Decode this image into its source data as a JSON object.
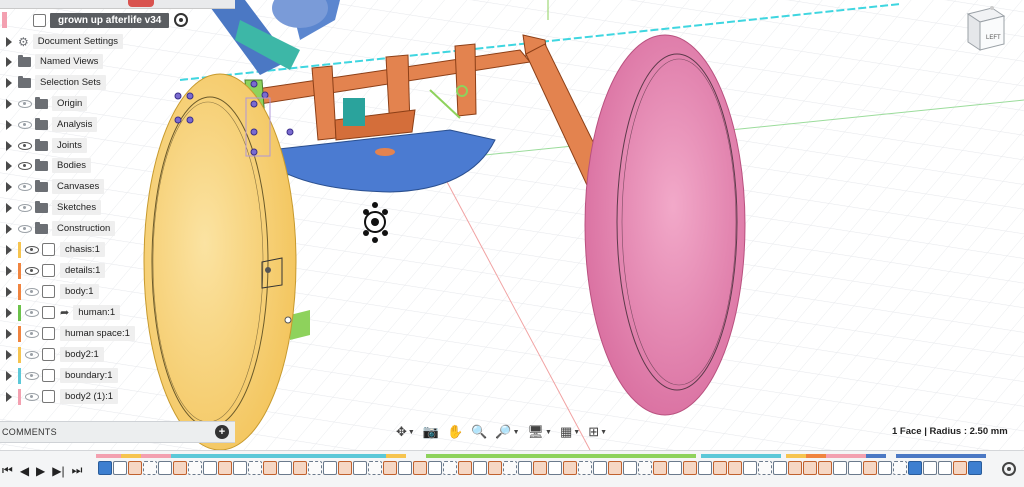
{
  "document": {
    "title": "grown up afterlife v34"
  },
  "browser": {
    "items": [
      {
        "label": "Document Settings",
        "kind": "settings"
      },
      {
        "label": "Named Views",
        "kind": "folder"
      },
      {
        "label": "Selection Sets",
        "kind": "folder"
      },
      {
        "label": "Origin",
        "kind": "folder"
      },
      {
        "label": "Analysis",
        "kind": "folder"
      },
      {
        "label": "Joints",
        "kind": "folder"
      },
      {
        "label": "Bodies",
        "kind": "folder"
      },
      {
        "label": "Canvases",
        "kind": "folder"
      },
      {
        "label": "Sketches",
        "kind": "folder"
      },
      {
        "label": "Construction",
        "kind": "folder"
      },
      {
        "label": "chasis:1",
        "kind": "component",
        "color": "#f6c44f"
      },
      {
        "label": "details:1",
        "kind": "component",
        "color": "#f0843f"
      },
      {
        "label": "body:1",
        "kind": "component",
        "color": "#f0843f"
      },
      {
        "label": "human:1",
        "kind": "component",
        "color": "#6cc24a"
      },
      {
        "label": "human space:1",
        "kind": "component",
        "color": "#f0843f"
      },
      {
        "label": "body2:1",
        "kind": "component",
        "color": "#f6c44f"
      },
      {
        "label": "boundary:1",
        "kind": "component",
        "color": "#5bc8d8"
      },
      {
        "label": "body2 (1):1",
        "kind": "component",
        "color": "#f3a0b0"
      }
    ]
  },
  "viewcube": {
    "face_label": "LEFT"
  },
  "comments": {
    "label": "COMMENTS",
    "add_symbol": "+"
  },
  "status": {
    "selection": "1 Face | Radius : 2.50 mm"
  },
  "nav_toolbar": {
    "tools": [
      "move-icon",
      "capture-icon",
      "pan-icon",
      "zoom-icon",
      "fit-icon",
      "display-settings-icon",
      "grid-icon",
      "viewports-icon"
    ]
  },
  "colors": {
    "yellow_wheel": "#f6d27a",
    "pink_wheel": "#e989b3",
    "orange_frame": "#e3834f",
    "blue_frame": "#4b78c4",
    "green_part": "#8ed25c",
    "teal_part": "#3db7a7"
  }
}
